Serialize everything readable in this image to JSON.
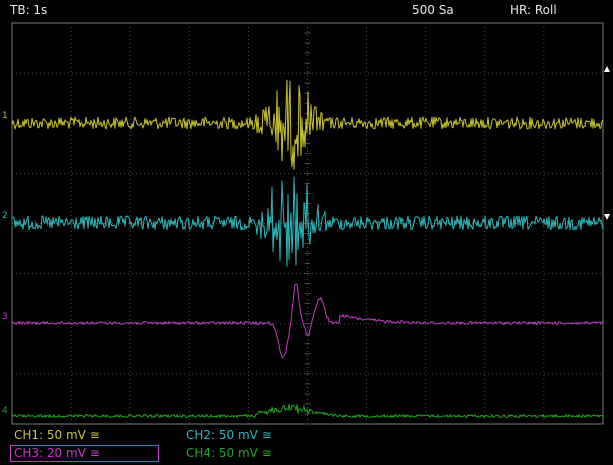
{
  "status": {
    "timebase": "TB: 1s",
    "samples": "500 Sa",
    "mode": "HR: Roll"
  },
  "channels": [
    {
      "id": "1",
      "label": "CH1: 50 mV ≅",
      "color": "#c9c52a",
      "marker": "1"
    },
    {
      "id": "2",
      "label": "CH2: 50 mV ≅",
      "color": "#2ab9bd",
      "marker": "2"
    },
    {
      "id": "3",
      "label": "CH3: 20 mV ≅",
      "color": "#c23bc2",
      "marker": "3",
      "selected": true
    },
    {
      "id": "4",
      "label": "CH4: 50 mV ≅",
      "color": "#23a323",
      "marker": "4"
    }
  ],
  "colors": {
    "grid": "#5a5a5a",
    "background": "#000000",
    "frame": "#7a7a7a"
  },
  "icons": [
    "trigger-up-arrow-icon",
    "trigger-down-arrow-icon"
  ]
}
